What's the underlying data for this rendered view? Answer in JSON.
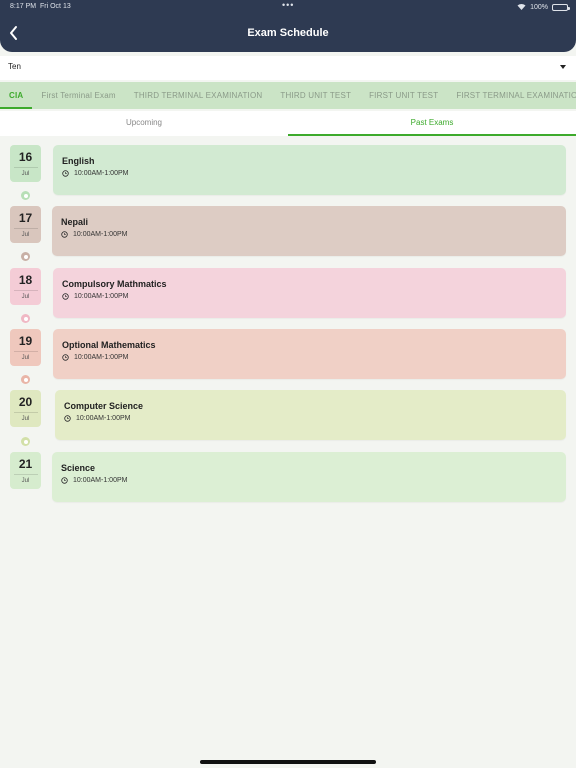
{
  "status_bar": {
    "time": "8:17 PM",
    "date": "Fri Oct 13",
    "battery": "100%"
  },
  "header": {
    "title": "Exam Schedule"
  },
  "class_select": {
    "value": "Ten"
  },
  "exam_tabs": [
    "CIA",
    "First Terminal Exam",
    "THIRD TERMINAL EXAMINATION",
    "THIRD UNIT TEST",
    "FIRST UNIT TEST",
    "FIRST TERMINAL EXAMINATION"
  ],
  "view_tabs": {
    "upcoming": "Upcoming",
    "past": "Past Exams"
  },
  "exams": [
    {
      "day": "16",
      "month": "Jul",
      "subject": "English",
      "time": "10:00AM-1:00PM",
      "card_color": "#d2ead2",
      "chip_color": "#c8e6c7",
      "dot_color": "#b7dfb6"
    },
    {
      "day": "17",
      "month": "Jul",
      "subject": "Nepali",
      "time": "10:00AM-1:00PM",
      "card_color": "#ddccc4",
      "chip_color": "#d9c6bd",
      "dot_color": "#c8b0a6"
    },
    {
      "day": "18",
      "month": "Jul",
      "subject": "Compulsory Mathmatics",
      "time": "10:00AM-1:00PM",
      "card_color": "#f4d3dc",
      "chip_color": "#f4ccd6",
      "dot_color": "#f0b8c4"
    },
    {
      "day": "19",
      "month": "Jul",
      "subject": "Optional Mathematics",
      "time": "10:00AM-1:00PM",
      "card_color": "#f0d0c6",
      "chip_color": "#efc8bd",
      "dot_color": "#e9b5a7"
    },
    {
      "day": "20",
      "month": "Jul",
      "subject": "Computer Science",
      "time": "10:00AM-1:00PM",
      "card_color": "#e4ecc8",
      "chip_color": "#dfe8c0",
      "dot_color": "#d2e0a8"
    },
    {
      "day": "21",
      "month": "Jul",
      "subject": "Science",
      "time": "10:00AM-1:00PM",
      "card_color": "#dcefd4",
      "chip_color": "#d6ecce",
      "dot_color": "#c5e4ba"
    }
  ]
}
